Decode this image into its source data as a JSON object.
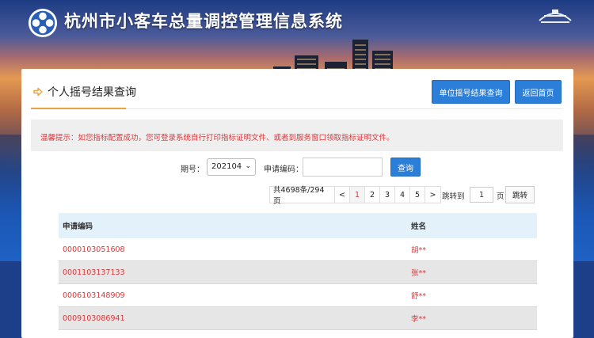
{
  "site": {
    "title": "杭州市小客车总量调控管理信息系统"
  },
  "panel": {
    "title": "个人摇号结果查询",
    "btn_unit": "单位摇号结果查询",
    "btn_home": "返回首页"
  },
  "notice": "温馨提示：如您指标配置成功，您可登录系统自行打印指标证明文件、或者到服务窗口领取指标证明文件。",
  "search": {
    "period_label": "期号：",
    "period_value": "202104",
    "code_label": "申请编码：",
    "code_value": "",
    "query_label": "查询"
  },
  "pager": {
    "total": "共4698条/294页",
    "prev": "<",
    "next": ">",
    "pages": [
      "1",
      "2",
      "3",
      "4",
      "5"
    ],
    "active_page": "1",
    "goto_label": "跳转到",
    "goto_value": "1",
    "goto_unit": "页",
    "goto_button": "跳转"
  },
  "table": {
    "headers": [
      "申请编码",
      "姓名"
    ],
    "rows": [
      [
        "0000103051608",
        "胡**"
      ],
      [
        "0001103137133",
        "张**"
      ],
      [
        "0006103148909",
        "舒**"
      ],
      [
        "0009103086941",
        "李**"
      ]
    ]
  },
  "colors": {
    "accent_blue": "#2c7fd9",
    "alert_red": "#d9383a",
    "title_underline": "#e8a33a",
    "table_header_bg": "#e3f1fb"
  }
}
